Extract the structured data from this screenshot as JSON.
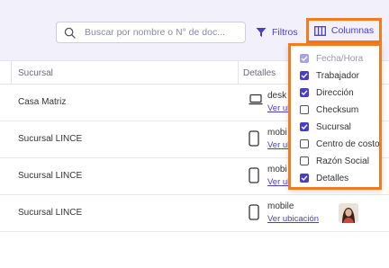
{
  "toolbar": {
    "search_placeholder": "Buscar por nombre o N° de doc...",
    "filters_label": "Filtros",
    "columns_label": "Columnas"
  },
  "table": {
    "headers": {
      "sucursal": "Sucursal",
      "detalles": "Detalles"
    },
    "rows": [
      {
        "sucursal": "Casa Matriz",
        "device": "desk",
        "device_icon": "laptop-icon",
        "location_link": "Ver ub"
      },
      {
        "sucursal": "Sucursal LINCE",
        "device": "mobi",
        "device_icon": "phone-icon",
        "location_link": "Ver ub"
      },
      {
        "sucursal": "Sucursal LINCE",
        "device": "mobi",
        "device_icon": "phone-icon",
        "location_link": "Ver ub"
      },
      {
        "sucursal": "Sucursal LINCE",
        "device": "mobile",
        "device_icon": "phone-icon",
        "location_link": "Ver ubicación"
      }
    ]
  },
  "columns_menu": {
    "options": [
      {
        "label": "Fecha/Hora",
        "checked": true,
        "disabled": true
      },
      {
        "label": "Trabajador",
        "checked": true,
        "disabled": false
      },
      {
        "label": "Dirección",
        "checked": true,
        "disabled": false
      },
      {
        "label": "Checksum",
        "checked": false,
        "disabled": false
      },
      {
        "label": "Sucursal",
        "checked": true,
        "disabled": false
      },
      {
        "label": "Centro de costo",
        "checked": false,
        "disabled": false
      },
      {
        "label": "Razón Social",
        "checked": false,
        "disabled": false
      },
      {
        "label": "Detalles",
        "checked": true,
        "disabled": false
      }
    ]
  },
  "colors": {
    "accent": "#4a3fc4",
    "highlight": "#f17b1f",
    "toolbar_bg": "#f1f0fb"
  }
}
